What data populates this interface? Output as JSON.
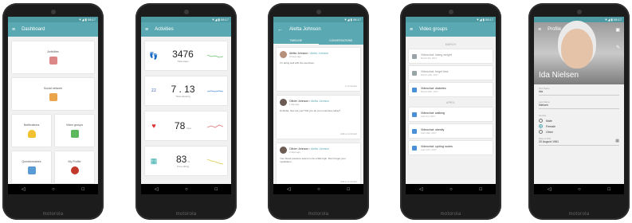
{
  "colors": {
    "accent": "#5aa8b1",
    "status_bar": "#4e9aa3",
    "phone_body": "#1c1c1c"
  },
  "brand": "motorola",
  "nav": {
    "back": "◁",
    "home": "○",
    "recent": "□"
  },
  "dashboard": {
    "title": "Dashboard",
    "tiles": [
      "Activities",
      "Social network",
      "Notifications",
      "Video groups",
      "Questionnaires",
      "My Profile"
    ]
  },
  "activities": {
    "title": "Activities",
    "steps": {
      "value": "3476",
      "label": "Total steps"
    },
    "sleep": {
      "value": "7 . 13",
      "label": "Total sleeping",
      "h": "h",
      "m": "m"
    },
    "heart": {
      "value": "78",
      "unit": "bpm"
    },
    "activity": {
      "value": "83",
      "unit": "%",
      "label": "Time sitting"
    }
  },
  "feed": {
    "title": "Aletta Johnson",
    "tabs": [
      "TIMELINE",
      "CONVERSATIONS"
    ],
    "posts": [
      {
        "author": "Aletta Johnson",
        "target": "Aletta Johnson",
        "time": "3 hours ago",
        "body": "I'm doing well with the exercises.",
        "action": "1 comment"
      },
      {
        "author": "Olivier Johnson",
        "target": "Aletta Johnson",
        "time": "1 day ago",
        "body": "Hi Aletta, how are you? Did you do your exercises today?",
        "action": "Add a comment"
      },
      {
        "author": "Olivier Johnson",
        "target": "Aletta Johnson",
        "time": "2 days ago",
        "body": "Your blood pressure seems to be a little high. Don't forget your medication.",
        "action": "Add a comment"
      }
    ]
  },
  "video_groups": {
    "title": "Video groups",
    "sections": [
      "MARCH",
      "APRIL"
    ],
    "march": [
      {
        "title": "Videochat: losing weight",
        "date": "March 6th, 2017",
        "active": false
      },
      {
        "title": "Videochat: forget less",
        "date": "March 13th, 2017",
        "active": false
      },
      {
        "title": "Videochat: diabetes",
        "date": "March 20th, 2017",
        "active": true
      }
    ],
    "april": [
      {
        "title": "Videochat: walking",
        "date": "April 3rd, 2017",
        "active": true
      },
      {
        "title": "Videochat: obesity",
        "date": "April 10th, 2017",
        "active": true
      },
      {
        "title": "Videochat: cycling routes",
        "date": "April 17th, 2017",
        "active": true
      }
    ]
  },
  "profile": {
    "title": "Profile",
    "name": "Ida Nielsen",
    "first_name_label": "First Name",
    "first_name": "Ida",
    "last_name_label": "Last Name",
    "last_name": "Nielsen",
    "gender_label": "Gender",
    "gender_options": [
      "Male",
      "Female",
      "Other"
    ],
    "selected_gender": "Female",
    "dob_label": "Date of birth",
    "dob": "20 August 1961"
  },
  "statusbar": {
    "time": "▼◢ ▮ 08:17"
  }
}
